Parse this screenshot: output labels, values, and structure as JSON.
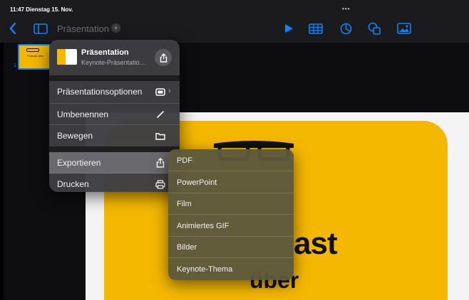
{
  "status": {
    "time_date": "11:47  Dienstag 15. Nov.",
    "dots": "•••"
  },
  "toolbar": {
    "doc_title": "Präsentation",
    "back_icon": "chevron-left-icon",
    "sidebar_icon": "sidebar-icon",
    "play_icon": "play-icon",
    "table_icon": "table-icon",
    "chart_icon": "chart-icon",
    "shapes_icon": "shapes-icon",
    "media_icon": "media-icon",
    "accent": "#0a84ff"
  },
  "navigator": {
    "slide_number": "1",
    "thumb_text": "Podcast über"
  },
  "slide": {
    "line1": "ast",
    "line2": "über",
    "bg_color": "#f5b800"
  },
  "menu": {
    "doc_name": "Präsentation",
    "doc_type": "Keynote-Präsentatio...",
    "items": [
      {
        "label": "Präsentationsoptionen",
        "icon": "presentation-options-icon"
      },
      {
        "label": "Umbenennen",
        "icon": "pencil-icon"
      },
      {
        "label": "Bewegen",
        "icon": "folder-icon"
      },
      {
        "label": "Exportieren",
        "icon": "share-icon"
      },
      {
        "label": "Drucken",
        "icon": "printer-icon"
      }
    ]
  },
  "export_menu": {
    "items": [
      "PDF",
      "PowerPoint",
      "Film",
      "Animiertes GIF",
      "Bilder",
      "Keynote-Thema"
    ]
  }
}
